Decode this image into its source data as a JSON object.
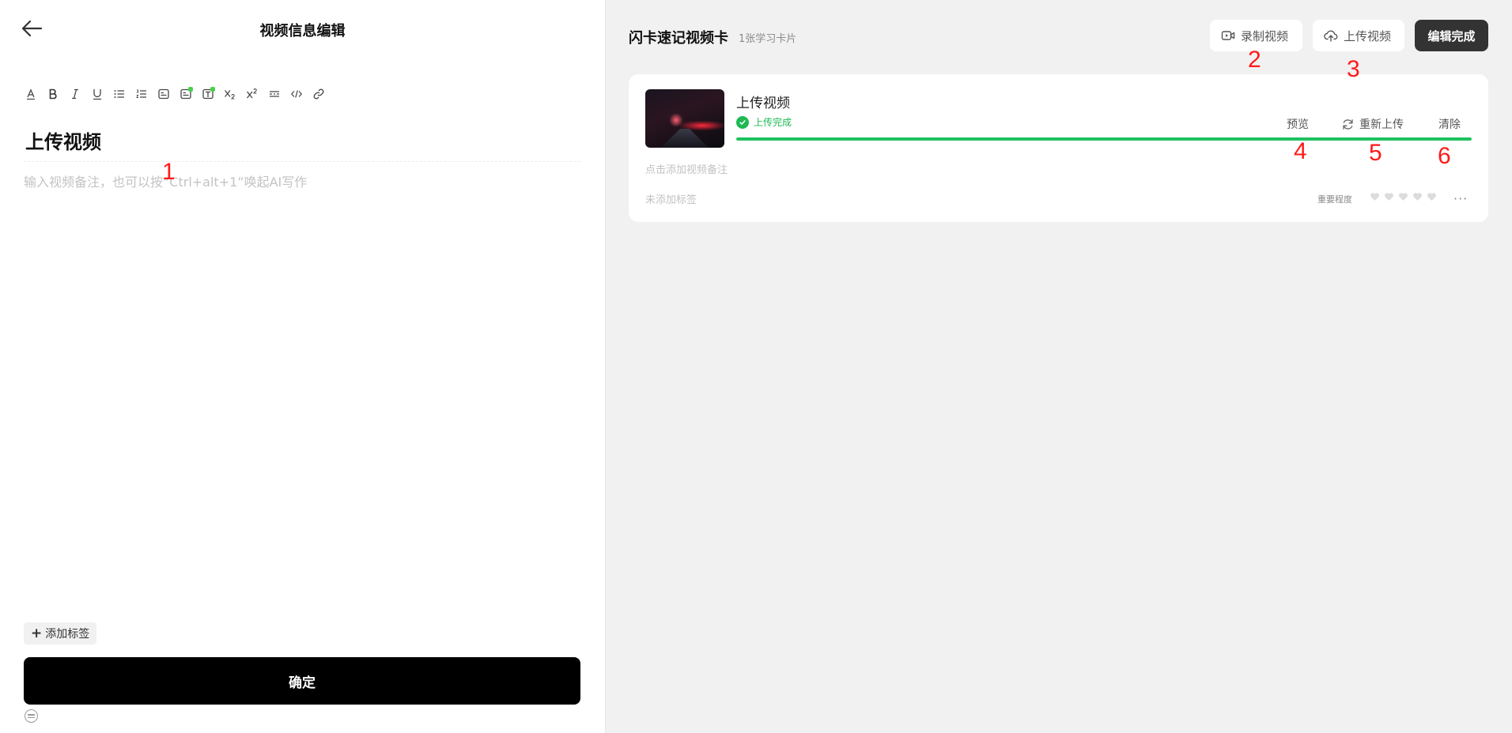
{
  "left_panel": {
    "title": "视频信息编辑",
    "toolbar": [
      "text-color",
      "bold",
      "italic",
      "underline",
      "bulleted-list",
      "numbered-list",
      "blank-card",
      "blank-card-plus",
      "text-card-plus",
      "subscript",
      "superscript",
      "cloze",
      "code",
      "link"
    ],
    "doc_title": "上传视频",
    "note_placeholder": "输入视频备注，也可以按“Ctrl+alt+1”唤起AI写作",
    "add_tag_label": "添加标签",
    "confirm_label": "确定"
  },
  "right_panel": {
    "title": "闪卡速记视频卡",
    "subtitle": "1张学习卡片",
    "buttons": {
      "record": "录制视频",
      "upload": "上传视频",
      "done": "编辑完成"
    },
    "card": {
      "title": "上传视频",
      "status": "上传完成",
      "progress": 1.0,
      "actions": {
        "preview": "预览",
        "reupload": "重新上传",
        "clear": "清除"
      },
      "note_placeholder": "点击添加视频备注",
      "tags_placeholder": "未添加标签",
      "importance_label": "重要程度",
      "importance_level": 0,
      "importance_max": 5,
      "more": "···"
    }
  },
  "annotations": {
    "a1": "1",
    "a2": "2",
    "a3": "3",
    "a4": "4",
    "a5": "5",
    "a6": "6"
  },
  "colors": {
    "accent_green": "#1fb954",
    "progress_green": "#1fc160",
    "annotation_red": "#ff1a1a",
    "primary_dark": "#000000",
    "done_button": "#333333"
  }
}
